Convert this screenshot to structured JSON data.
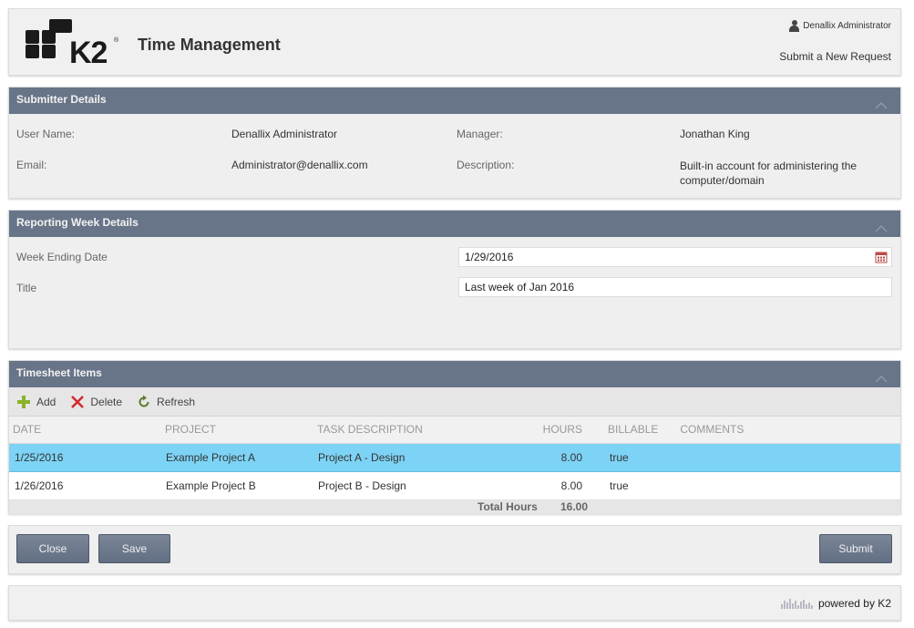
{
  "header": {
    "logo_text": "K2",
    "app_title": "Time Management",
    "user_name": "Denallix Administrator",
    "submit_link": "Submit a New Request"
  },
  "submitter": {
    "title": "Submitter Details",
    "user_name_label": "User Name:",
    "user_name_value": "Denallix Administrator",
    "email_label": "Email:",
    "email_value": "Administrator@denallix.com",
    "manager_label": "Manager:",
    "manager_value": "Jonathan King",
    "description_label": "Description:",
    "description_value": "Built-in account for administering the computer/domain"
  },
  "reporting": {
    "title": "Reporting Week Details",
    "week_ending_label": "Week Ending Date",
    "week_ending_value": "1/29/2016",
    "title_label": "Title",
    "title_value": "Last week of Jan 2016"
  },
  "timesheet": {
    "title": "Timesheet Items",
    "toolbar": {
      "add": "Add",
      "delete": "Delete",
      "refresh": "Refresh"
    },
    "columns": [
      "DATE",
      "PROJECT",
      "TASK DESCRIPTION",
      "HOURS",
      "BILLABLE",
      "COMMENTS"
    ],
    "rows": [
      {
        "date": "1/25/2016",
        "project": "Example Project A",
        "task": "Project A - Design",
        "hours": "8.00",
        "billable": "true",
        "comments": ""
      },
      {
        "date": "1/26/2016",
        "project": "Example Project B",
        "task": "Project B - Design",
        "hours": "8.00",
        "billable": "true",
        "comments": ""
      }
    ],
    "total_label": "Total Hours",
    "total_value": "16.00"
  },
  "actions": {
    "close": "Close",
    "save": "Save",
    "submit": "Submit"
  },
  "footer": {
    "powered_by": "powered by K2"
  },
  "colors": {
    "section_header": "#687487",
    "selected_row": "#7dd3f5",
    "button": "#687487",
    "add_icon": "#8ab32a",
    "delete_icon": "#d22b2b",
    "refresh_icon": "#5e7a2a"
  }
}
